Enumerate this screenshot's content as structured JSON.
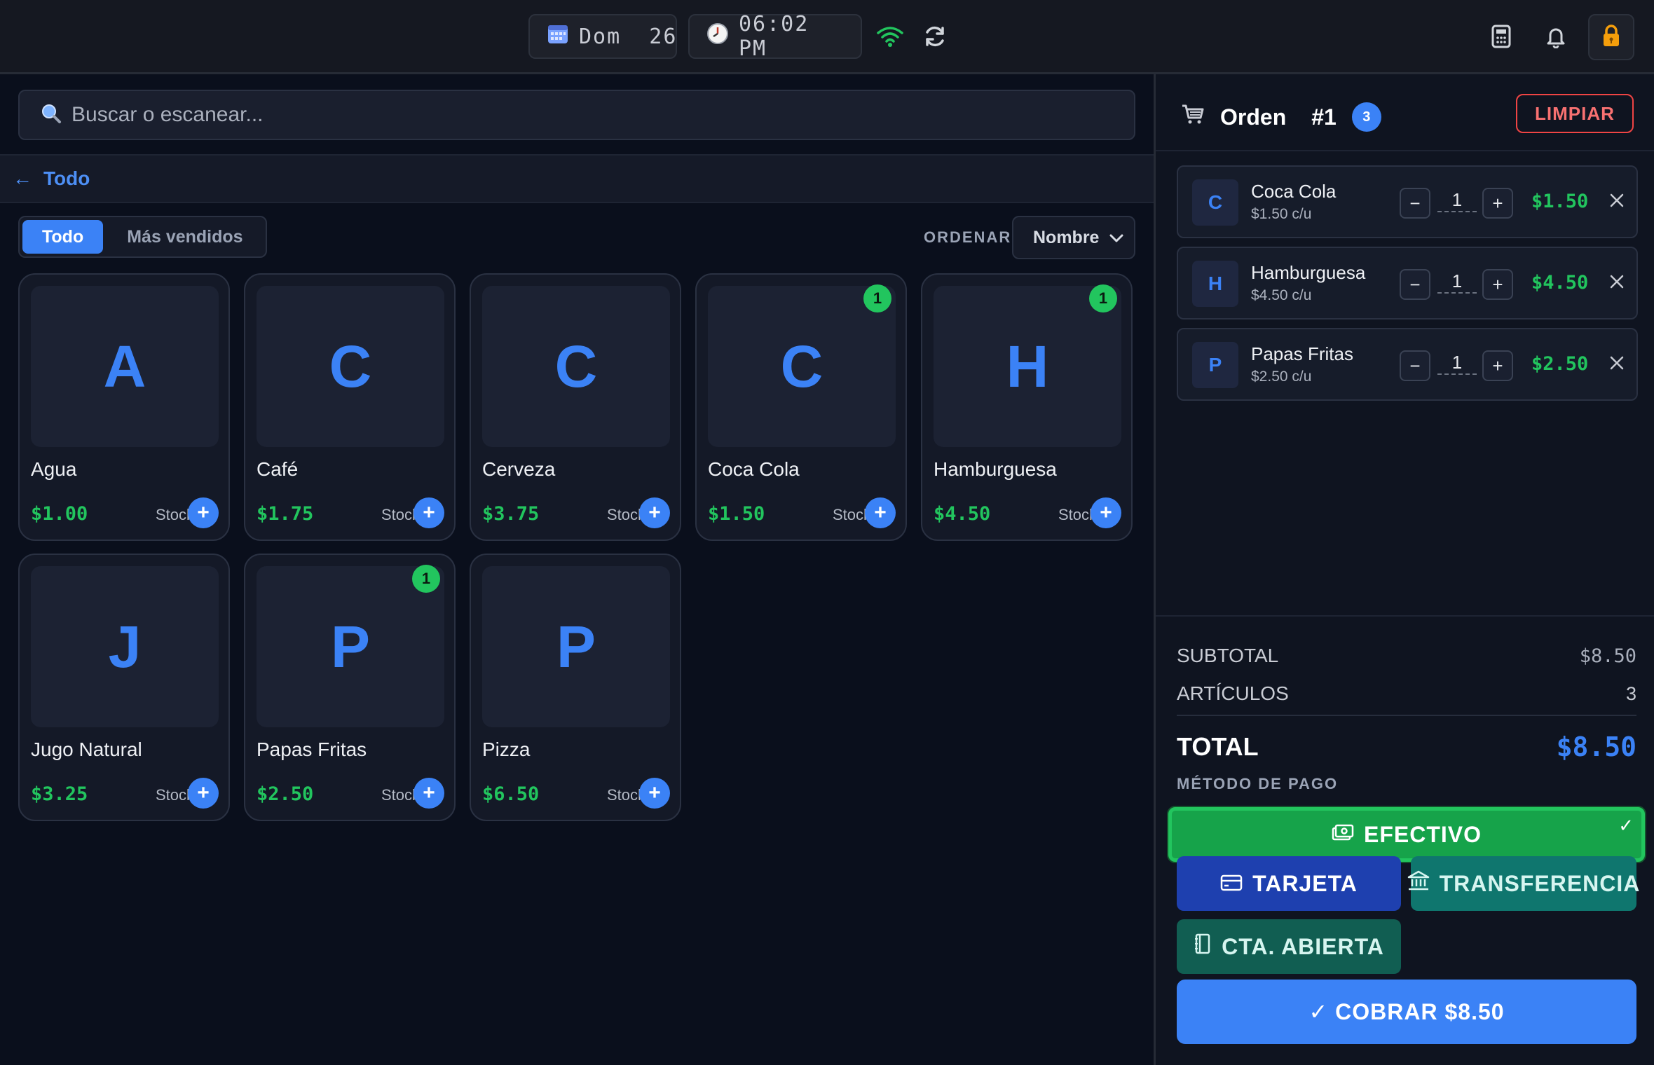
{
  "topbar": {
    "date": "Dom  26",
    "time": "06:02 PM"
  },
  "search": {
    "placeholder": "Buscar o escanear..."
  },
  "breadcrumb": {
    "arrow": "←",
    "label": "Todo"
  },
  "tabs": [
    {
      "label": "Todo",
      "active": true
    },
    {
      "label": "Más vendidos",
      "active": false
    }
  ],
  "sort": {
    "label": "ORDENAR",
    "value": "Nombre"
  },
  "products": [
    {
      "letter": "A",
      "name": "Agua",
      "price": "$1.00",
      "stock": "Stock",
      "badge": ""
    },
    {
      "letter": "C",
      "name": "Café",
      "price": "$1.75",
      "stock": "Stock",
      "badge": ""
    },
    {
      "letter": "C",
      "name": "Cerveza",
      "price": "$3.75",
      "stock": "Stock",
      "badge": ""
    },
    {
      "letter": "C",
      "name": "Coca Cola",
      "price": "$1.50",
      "stock": "Stock",
      "badge": "1"
    },
    {
      "letter": "H",
      "name": "Hamburguesa",
      "price": "$4.50",
      "stock": "Stock",
      "badge": "1"
    },
    {
      "letter": "J",
      "name": "Jugo Natural",
      "price": "$3.25",
      "stock": "Stock",
      "badge": ""
    },
    {
      "letter": "P",
      "name": "Papas Fritas",
      "price": "$2.50",
      "stock": "Stock",
      "badge": "1"
    },
    {
      "letter": "P",
      "name": "Pizza",
      "price": "$6.50",
      "stock": "Stock",
      "badge": ""
    }
  ],
  "order": {
    "title": "Orden",
    "number": "#1",
    "count": "3",
    "clear_label": "LIMPIAR",
    "items": [
      {
        "letter": "C",
        "name": "Coca Cola",
        "unit": "$1.50 c/u",
        "qty": "1",
        "total": "$1.50"
      },
      {
        "letter": "H",
        "name": "Hamburguesa",
        "unit": "$4.50 c/u",
        "qty": "1",
        "total": "$4.50"
      },
      {
        "letter": "P",
        "name": "Papas Fritas",
        "unit": "$2.50 c/u",
        "qty": "1",
        "total": "$2.50"
      }
    ]
  },
  "summary": {
    "subtotal_label": "SUBTOTAL",
    "subtotal": "$8.50",
    "items_label": "ARTÍCULOS",
    "items": "3",
    "total_label": "TOTAL",
    "total": "$8.50",
    "payment_label": "MÉTODO DE PAGO"
  },
  "payment": {
    "cash": "EFECTIVO",
    "card": "TARJETA",
    "transfer": "TRANSFERENCIA",
    "open_account": "CTA. ABIERTA",
    "selected_mark": "✓"
  },
  "charge": {
    "label": "✓ COBRAR $8.50"
  },
  "colors": {
    "accent": "#3b82f6",
    "price_green": "#22c55e",
    "danger": "#ef4444"
  }
}
